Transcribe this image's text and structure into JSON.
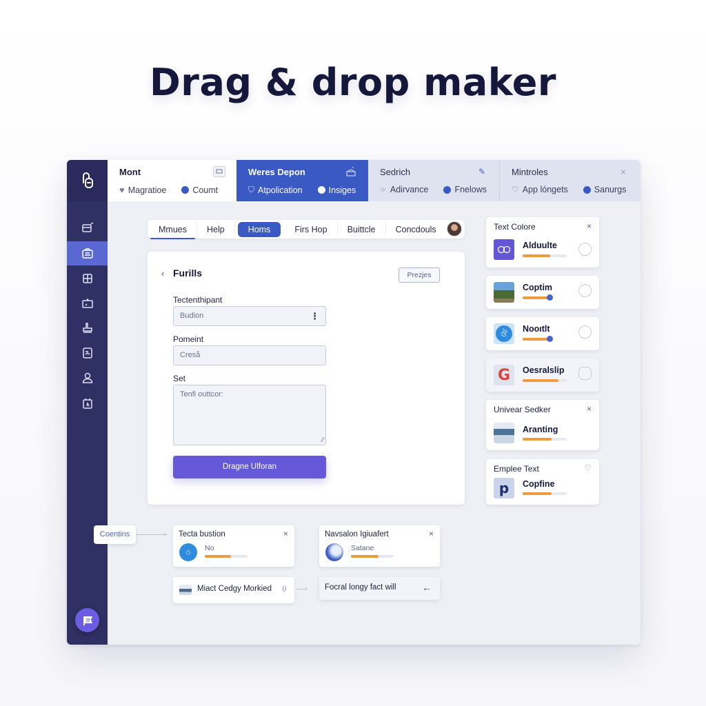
{
  "hero": {
    "title": "Drag & drop maker"
  },
  "sidebar": {
    "logo_icon": "paperclip-doc-icon",
    "items": [
      {
        "icon": "card-edit-icon",
        "active": false
      },
      {
        "icon": "image-frame-icon",
        "active": true
      },
      {
        "icon": "grid-box-icon",
        "active": false
      },
      {
        "icon": "folder-open-icon",
        "active": false
      },
      {
        "icon": "stamp-icon",
        "active": false
      },
      {
        "icon": "document-chart-icon",
        "active": false
      },
      {
        "icon": "user-icon",
        "active": false
      },
      {
        "icon": "calendar-icon",
        "active": false
      }
    ],
    "fab_icon": "flag-icon"
  },
  "topbar": {
    "groups": [
      {
        "title": "Mont",
        "icon": "monitor-icon",
        "items": [
          {
            "icon": "heart-icon",
            "label": "Magratioe"
          },
          {
            "icon": "info-dot-icon",
            "label": "Coumt"
          }
        ]
      },
      {
        "title": "Weres Depon",
        "icon": "cake-icon",
        "items": [
          {
            "icon": "shield-icon",
            "label": "Atpolication"
          },
          {
            "icon": "circle-icon",
            "label": "Insiges"
          }
        ]
      },
      {
        "title": "Sedrich",
        "icon": "pencil-icon",
        "items": [
          {
            "icon": "pointer-icon",
            "label": "Adirvance"
          },
          {
            "icon": "check-circle-icon",
            "label": "Fnelows"
          }
        ]
      },
      {
        "title": "Mintroles",
        "icon": "close-icon",
        "items": [
          {
            "icon": "heart-outline-icon",
            "label": "App lóngets"
          },
          {
            "icon": "check-circle-icon",
            "label": "Sanurgs"
          }
        ]
      }
    ]
  },
  "tabs": [
    {
      "label": "Mmues",
      "state": "underlined"
    },
    {
      "label": "Help",
      "state": ""
    },
    {
      "label": "Homs",
      "state": "active"
    },
    {
      "label": "Firs Hop",
      "state": ""
    },
    {
      "label": "Buittcle",
      "state": ""
    },
    {
      "label": "Concdouls",
      "state": ""
    }
  ],
  "form": {
    "back_label": "‹",
    "title": "Furills",
    "preview_label": "Prezjes",
    "fields": [
      {
        "label": "Tectenthipant",
        "value": "Budion",
        "type": "select"
      },
      {
        "label": "Pomeint",
        "placeholder": "Creså",
        "type": "text"
      },
      {
        "label": "Set",
        "placeholder": "Tenfi outtcor:",
        "type": "textarea"
      }
    ],
    "submit_label": "Dragne Ulforan"
  },
  "right_panel": [
    {
      "header": "Text Colore",
      "header_action": "×",
      "name": "Alduulte",
      "progress": 0.62,
      "knob": false,
      "thumb": "mask-icon"
    },
    {
      "header": "",
      "name": "Coptim",
      "progress": 0.6,
      "knob": true,
      "thumb": "landscape-photo"
    },
    {
      "header": "",
      "name": "Nooıtlt",
      "progress": 0.6,
      "knob": true,
      "thumb": "brain-badge-icon"
    },
    {
      "header": "",
      "name": "Oesralslip",
      "progress": 0.82,
      "knob": false,
      "thumb": "google-g-icon"
    },
    {
      "header": "Univear Sedker",
      "header_action": "×",
      "name": "Aranting",
      "progress": 0.65,
      "knob": false,
      "thumb": "seascape-photo"
    },
    {
      "header": "Emplee Text",
      "header_action": "♡",
      "name": "Copfine",
      "progress": 0.65,
      "knob": false,
      "thumb": "logo-p-icon"
    }
  ],
  "canvas": {
    "chip_label": "Coentins",
    "cards": [
      {
        "title": "Tecta bustion",
        "sub": "No",
        "progress": 0.62,
        "action": "×"
      },
      {
        "title": "Navsalon Igiuafert",
        "sub": "Satane",
        "progress": 0.65,
        "action": "×"
      }
    ],
    "rows": [
      {
        "text": "Miact Cedgy Morkied",
        "trail": "lock-icon"
      },
      {
        "text": "Focral longy fact will",
        "trail": "arrow-left-icon"
      }
    ]
  }
}
